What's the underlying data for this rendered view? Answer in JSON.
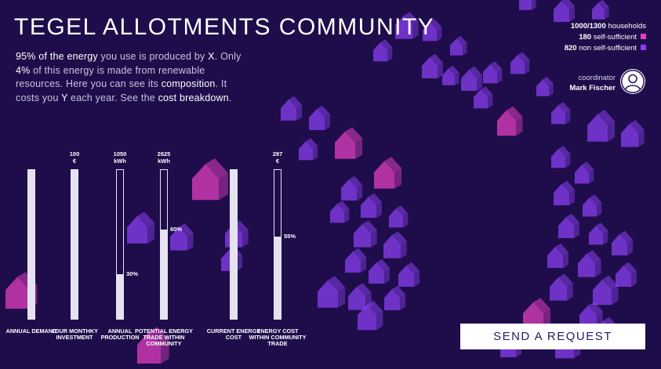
{
  "header": {
    "title": "TEGEL ALLOTMENTS COMMUNITY"
  },
  "intro": {
    "p1": "95% of the energy",
    "p2": " you use is produced by ",
    "p3": "X",
    "p4": ". Only ",
    "p5": "4%",
    "p6": " of this energy is made from renewable resources. Here you can see its ",
    "p7": "composition",
    "p8": ". It costs you ",
    "p9": "Y",
    "p10": " each year. See the ",
    "p11": "cost breakdown",
    "p12": "."
  },
  "stats": {
    "households_count": "1000/1300",
    "households_label": " households",
    "self_count": "180",
    "self_label": " self-sufficient",
    "self_color": "#e23fc0",
    "non_count": "820",
    "non_label": " non self-sufficient",
    "non_color": "#8a3ff0"
  },
  "coordinator": {
    "label": "coordinator",
    "name": "Mark Fischer",
    "icon": "user-avatar-icon"
  },
  "metrics": [
    {
      "label": "ANNUAL DEMAND",
      "value": "",
      "fill": 1.0,
      "pct": ""
    },
    {
      "label": "YOUR MONTHKY INVESTMENT",
      "value": "100\n€",
      "fill": 1.0,
      "pct": ""
    },
    {
      "label": "ANNUAL PRODUCTION",
      "value": "1050\nkWh",
      "fill": 0.3,
      "pct": "30%"
    },
    {
      "label": "POTENTIAL ENERGY TRADE WITHIN COMMUNITY",
      "value": "2625\nkWh",
      "fill": 0.6,
      "pct": "60%"
    },
    {
      "label": "CURRENT ENERGY COST",
      "value": "",
      "fill": 1.0,
      "pct": ""
    },
    {
      "label": "ENERGY COST WITHIN COMMUNITY TRADE",
      "value": "297\n€",
      "fill": 0.55,
      "pct": "55%"
    }
  ],
  "actions": {
    "send_label": "SEND A REQUEST"
  },
  "colors": {
    "background": "#1e0d4a",
    "house_purple": "#8a3ff0",
    "house_magenta": "#e23fc0",
    "bar": "#e6e3f0"
  }
}
